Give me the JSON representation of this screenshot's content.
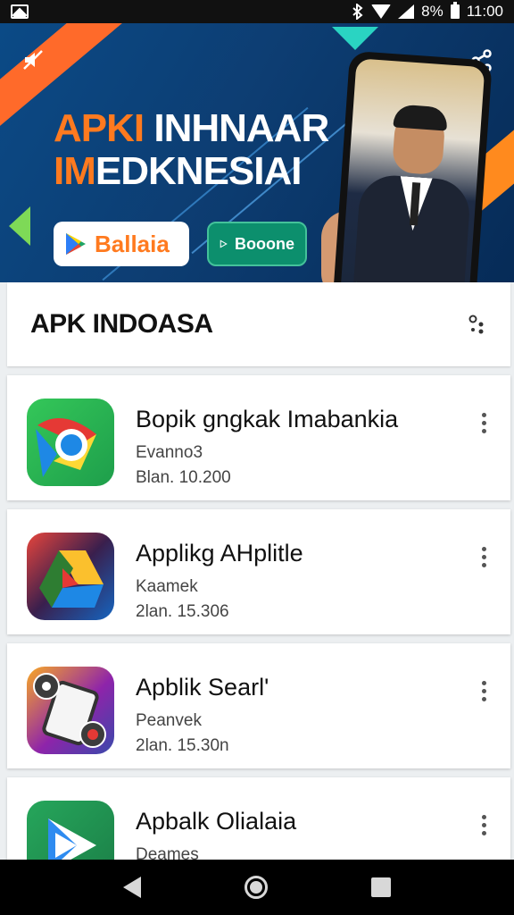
{
  "status_bar": {
    "battery_percent": "8%",
    "time": "11:00",
    "icons": [
      "gallery-icon",
      "bluetooth-icon",
      "wifi-icon",
      "signal-icon",
      "battery-icon"
    ]
  },
  "banner": {
    "headline_line1_part1": "APKI ",
    "headline_line1_part2": "INHNAAR",
    "headline_line2_part1": "IM",
    "headline_line2_part2": "EDKNESIAI",
    "store_button_1": "Ballaia",
    "store_button_2": "Booone",
    "colors": {
      "orange": "#ff7a1f",
      "navy": "#0b4a86",
      "green": "#0c8f6d",
      "teal": "#2ad4c2"
    },
    "icons": [
      "mute-icon",
      "share-icon",
      "play-store-icon"
    ]
  },
  "header": {
    "title": "APK INDOASA",
    "menu_icon": "more-options-icon"
  },
  "apps": [
    {
      "title": "Bopik gngkak Imabankia",
      "subtitle": "Evanno3",
      "date": "Blan. 10.200",
      "icon": "chrome-icon"
    },
    {
      "title": "Applikg AHplitle",
      "subtitle": "Kaamek",
      "date": "2lan. 15.306",
      "icon": "drive-icon"
    },
    {
      "title": "Apblik Searl'",
      "subtitle": "Peanvek",
      "date": "2lan. 15.30n",
      "icon": "tablet-icon"
    },
    {
      "title": "Apbalk Olialaia",
      "subtitle": "Deames",
      "date": "",
      "icon": "play-icon"
    }
  ],
  "nav": {
    "icons": [
      "back-icon",
      "home-icon",
      "recent-apps-icon"
    ]
  }
}
